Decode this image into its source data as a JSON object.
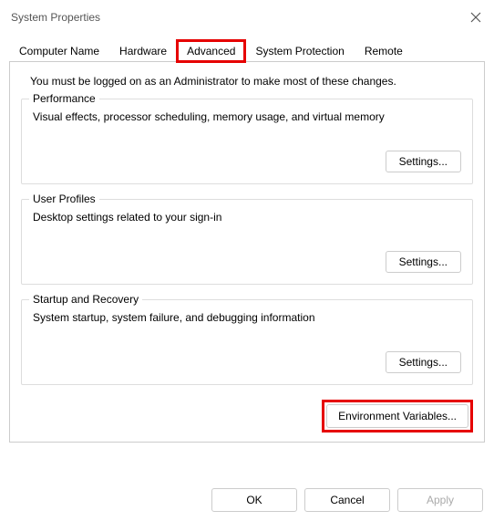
{
  "window": {
    "title": "System Properties"
  },
  "tabs": {
    "computerName": "Computer Name",
    "hardware": "Hardware",
    "advanced": "Advanced",
    "systemProtection": "System Protection",
    "remote": "Remote"
  },
  "adminNote": "You must be logged on as an Administrator to make most of these changes.",
  "groups": {
    "performance": {
      "title": "Performance",
      "desc": "Visual effects, processor scheduling, memory usage, and virtual memory",
      "button": "Settings..."
    },
    "userProfiles": {
      "title": "User Profiles",
      "desc": "Desktop settings related to your sign-in",
      "button": "Settings..."
    },
    "startupRecovery": {
      "title": "Startup and Recovery",
      "desc": "System startup, system failure, and debugging information",
      "button": "Settings..."
    }
  },
  "envButton": "Environment Variables...",
  "dialogButtons": {
    "ok": "OK",
    "cancel": "Cancel",
    "apply": "Apply"
  }
}
